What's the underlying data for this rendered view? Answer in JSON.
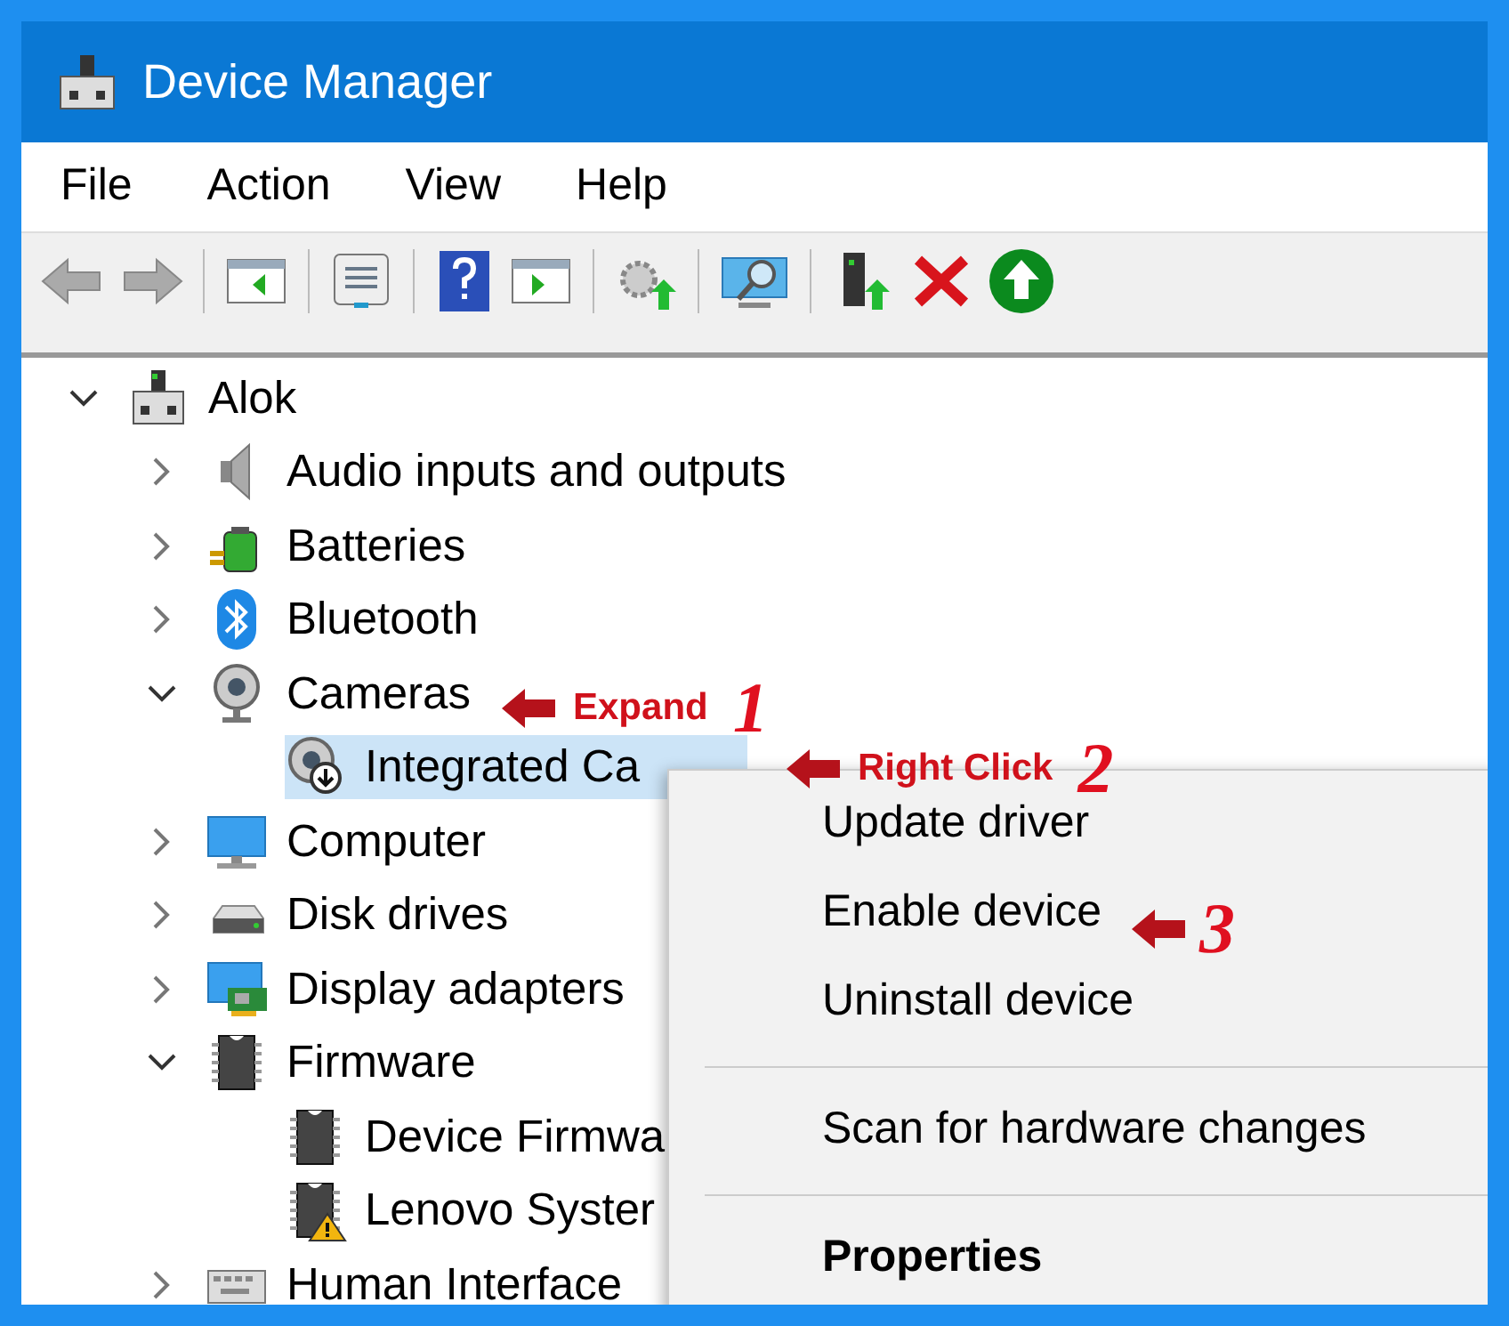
{
  "window": {
    "title": "Device Manager"
  },
  "menu_bar": [
    "File",
    "Action",
    "View",
    "Help"
  ],
  "tree": {
    "label": "Alok",
    "expanded": true,
    "selected": false,
    "warning": false,
    "children": [
      {
        "label": "Audio inputs and outputs",
        "expanded": false,
        "selected": false,
        "warning": false
      },
      {
        "label": "Batteries",
        "expanded": false,
        "selected": false,
        "warning": false
      },
      {
        "label": "Bluetooth",
        "expanded": false,
        "selected": false,
        "warning": false
      },
      {
        "label": "Cameras",
        "expanded": true,
        "selected": false,
        "warning": false,
        "children": [
          {
            "label": "Integrated Ca",
            "selected": true,
            "warning": false
          }
        ]
      },
      {
        "label": "Computer",
        "expanded": false,
        "selected": false,
        "warning": false
      },
      {
        "label": "Disk drives",
        "expanded": false,
        "selected": false,
        "warning": false
      },
      {
        "label": "Display adapters",
        "expanded": false,
        "selected": false,
        "warning": false
      },
      {
        "label": "Firmware",
        "expanded": true,
        "selected": false,
        "warning": false,
        "children": [
          {
            "label": "Device Firmwa",
            "selected": false,
            "warning": false
          },
          {
            "label": "Lenovo Syster",
            "selected": false,
            "warning": true
          }
        ]
      },
      {
        "label": "Human Interface",
        "expanded": false,
        "selected": false,
        "warning": false
      }
    ]
  },
  "context_menu": [
    {
      "label": "Update driver",
      "default": false,
      "separator_after": false
    },
    {
      "label": "Enable device",
      "default": false,
      "separator_after": false
    },
    {
      "label": "Uninstall device",
      "default": false,
      "separator_after": true
    },
    {
      "label": "Scan for hardware changes",
      "default": false,
      "separator_after": true
    },
    {
      "label": "Properties",
      "default": true,
      "separator_after": false
    }
  ],
  "annotations": [
    {
      "label": "Expand",
      "number": "1"
    },
    {
      "label": "Right Click",
      "number": "2"
    },
    {
      "number": "3"
    }
  ]
}
